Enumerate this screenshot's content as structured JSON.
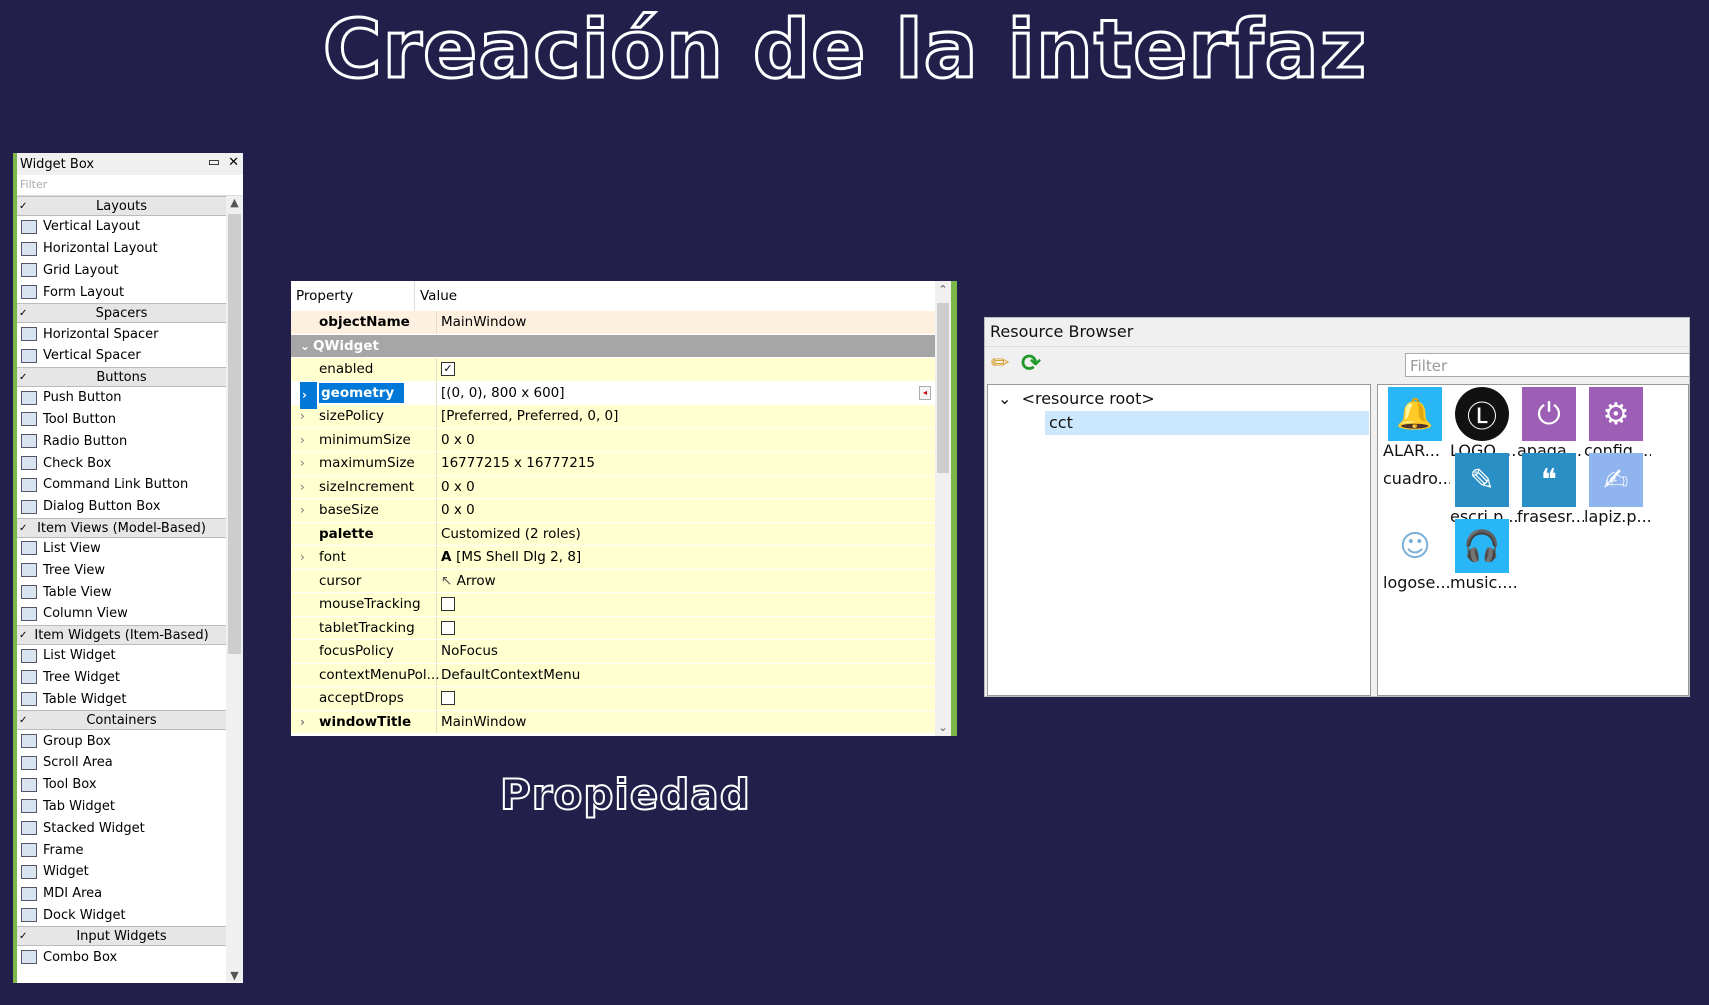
{
  "slide": {
    "title": "Creación de la interfaz",
    "caption": "Propiedad"
  },
  "widget_box": {
    "title": "Widget Box",
    "filter_placeholder": "Filter",
    "categories": [
      {
        "label": "Layouts",
        "items": [
          "Vertical Layout",
          "Horizontal Layout",
          "Grid Layout",
          "Form Layout"
        ]
      },
      {
        "label": "Spacers",
        "items": [
          "Horizontal Spacer",
          "Vertical Spacer"
        ]
      },
      {
        "label": "Buttons",
        "items": [
          "Push Button",
          "Tool Button",
          "Radio Button",
          "Check Box",
          "Command Link Button",
          "Dialog Button Box"
        ]
      },
      {
        "label": "Item Views (Model-Based)",
        "items": [
          "List View",
          "Tree View",
          "Table View",
          "Column View"
        ]
      },
      {
        "label": "Item Widgets (Item-Based)",
        "items": [
          "List Widget",
          "Tree Widget",
          "Table Widget"
        ]
      },
      {
        "label": "Containers",
        "items": [
          "Group Box",
          "Scroll Area",
          "Tool Box",
          "Tab Widget",
          "Stacked Widget",
          "Frame",
          "Widget",
          "MDI Area",
          "Dock Widget"
        ]
      },
      {
        "label": "Input Widgets",
        "items": [
          "Combo Box"
        ]
      }
    ]
  },
  "property_editor": {
    "col_property": "Property",
    "col_value": "Value",
    "object_name_label": "objectName",
    "object_name_value": "MainWindow",
    "group": "QWidget",
    "rows": [
      {
        "name": "enabled",
        "value": "",
        "check": true
      },
      {
        "name": "geometry",
        "value": "[(0, 0), 800 x 600]"
      },
      {
        "name": "sizePolicy",
        "value": "[Preferred, Preferred, 0, 0]"
      },
      {
        "name": "minimumSize",
        "value": "0 x 0"
      },
      {
        "name": "maximumSize",
        "value": "16777215 x 16777215"
      },
      {
        "name": "sizeIncrement",
        "value": "0 x 0"
      },
      {
        "name": "baseSize",
        "value": "0 x 0"
      },
      {
        "name": "palette",
        "value": "Customized (2 roles)"
      },
      {
        "name": "font",
        "value": "[MS Shell Dlg 2, 8]"
      },
      {
        "name": "cursor",
        "value": "Arrow"
      },
      {
        "name": "mouseTracking",
        "value": "",
        "check": false
      },
      {
        "name": "tabletTracking",
        "value": "",
        "check": false
      },
      {
        "name": "focusPolicy",
        "value": "NoFocus"
      },
      {
        "name": "contextMenuPol...",
        "value": "DefaultContextMenu"
      },
      {
        "name": "acceptDrops",
        "value": "",
        "check": false
      },
      {
        "name": "windowTitle",
        "value": "MainWindow"
      }
    ]
  },
  "resource_browser": {
    "title": "Resource Browser",
    "filter_placeholder": "Filter",
    "tree_root": "<resource root>",
    "tree_child": "cct",
    "resources": [
      {
        "label": "ALAR...",
        "color": "#29b6f6"
      },
      {
        "label": "LOGO ...",
        "color": "#111111"
      },
      {
        "label": "apaga...",
        "color": "#9c5fb5"
      },
      {
        "label": "config....",
        "color": "#9c5fb5"
      },
      {
        "label": "cuadro...",
        "color": ""
      },
      {
        "label": "escri.p...",
        "color": "#2a8fc4"
      },
      {
        "label": "frasesr....",
        "color": "#2a8fc4"
      },
      {
        "label": "lapiz.p...",
        "color": "#8fb4ee"
      },
      {
        "label": "logose...",
        "color": ""
      },
      {
        "label": "music....",
        "color": "#29b6f6"
      }
    ]
  }
}
